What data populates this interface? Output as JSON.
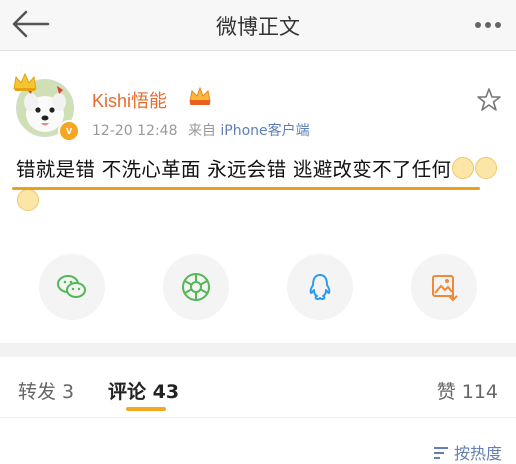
{
  "header": {
    "title": "微博正文"
  },
  "post": {
    "username": "Kishi悟能",
    "time": "12-20 12:48",
    "source_prefix": "来自",
    "source": "iPhone客户端",
    "text": "错就是错 不洗心革面 永远会错 逃避改变不了任何",
    "verified_mark": "v"
  },
  "share": {
    "items": [
      "wechat-icon",
      "moments-icon",
      "qq-icon",
      "save-image-icon"
    ]
  },
  "tabs": {
    "repost": "转发 3",
    "comments": "评论 43",
    "likes": "赞 114"
  },
  "sort": {
    "label": "按热度"
  },
  "colors": {
    "accent": "#f5a623",
    "username": "#e86b2f",
    "link": "#5d7fb5"
  }
}
